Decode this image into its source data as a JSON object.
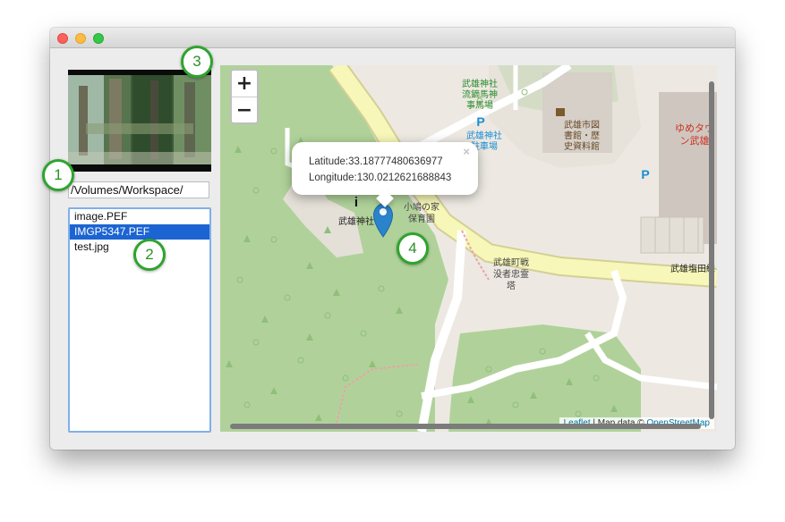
{
  "window": {
    "controls": [
      "close",
      "minimize",
      "maximize"
    ],
    "path_field": {
      "value": "/Volumes/Workspace/"
    },
    "files": [
      {
        "name": "image.PEF",
        "selected": false
      },
      {
        "name": "IMGP5347.PEF",
        "selected": true
      },
      {
        "name": "test.jpg",
        "selected": false
      }
    ]
  },
  "map": {
    "zoom_in_label": "+",
    "zoom_out_label": "−",
    "popup": {
      "latitude": "Latitude:33.18777480636977",
      "longitude": "Longitude:130.0212621688843",
      "close_label": "×"
    },
    "labels": {
      "shrine_horse": [
        "武雄神社",
        "流鏑馬神",
        "事馬場"
      ],
      "shrine_parking": [
        "武雄神社",
        "駐車場"
      ],
      "library": [
        "武雄市図",
        "書館・歴",
        "史資料館"
      ],
      "youme": [
        "ゆめタウ",
        "ン武雄"
      ],
      "shrine": "武雄神社",
      "nursery": [
        "小鳩の家",
        "保育園"
      ],
      "memorial": [
        "武雄町戦",
        "没者忠霊",
        "塔"
      ],
      "road": "武雄塩田線",
      "parking_symbol": "P",
      "info_symbol": "i"
    },
    "attribution": {
      "leaflet": "Leaflet",
      "text": " | Map data © ",
      "osm": "OpenStreetMap"
    },
    "colors": {
      "park": "#b0d29a",
      "land": "#ede9e2",
      "main_road": "#f7f7b9",
      "road_edge": "#d4cf94",
      "building": "#d6d0c8",
      "marker": "#2b83cb",
      "parking": "#1a8ed5",
      "road_label": "#222222"
    }
  },
  "callouts": [
    "1",
    "2",
    "3",
    "4"
  ]
}
